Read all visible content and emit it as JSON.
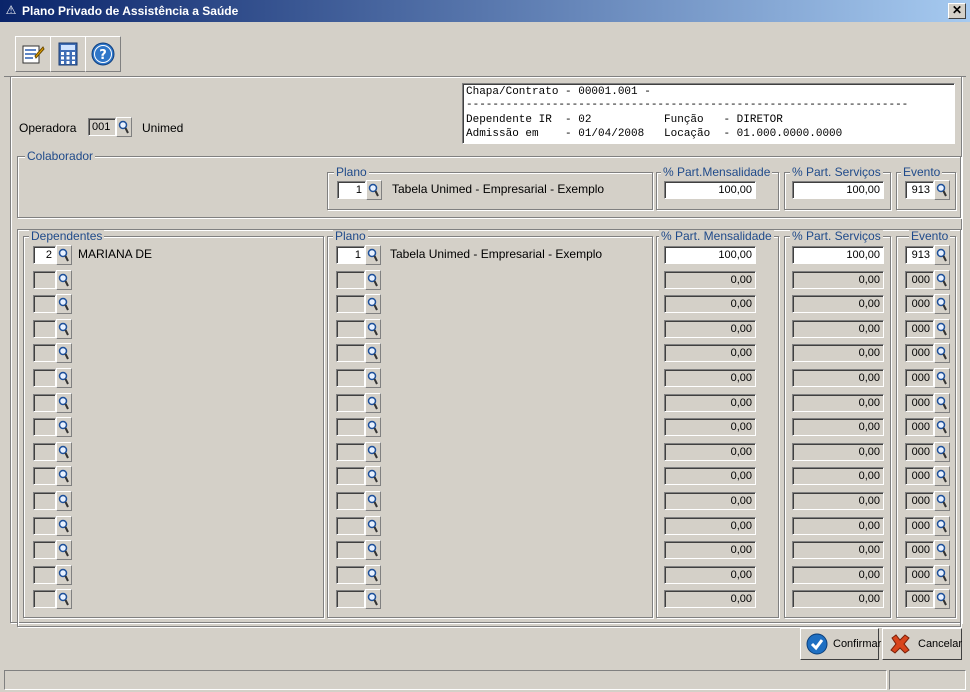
{
  "window": {
    "title": "Plano Privado de Assistência a Saúde",
    "close": "✕"
  },
  "toolbar": {
    "items": [
      {
        "icon": "edit-icon"
      },
      {
        "icon": "calculator-icon"
      },
      {
        "icon": "help-icon"
      }
    ]
  },
  "operadora": {
    "label": "Operadora",
    "code": "001",
    "name": "Unimed"
  },
  "info": {
    "line1": "Chapa/Contrato - 00001.001 -",
    "line2": "-------------------------------------------------------------------",
    "line3": "Dependente IR  - 02           Função   - DIRETOR",
    "line4": "Admissão em    - 01/04/2008   Locação  - 01.000.0000.0000"
  },
  "colaborador": {
    "legend": "Colaborador",
    "plano_legend": "Plano",
    "plano_code": "1",
    "plano_name": "Tabela Unimed - Empresarial - Exemplo",
    "mensalidade_legend": "% Part.Mensalidade",
    "mensalidade": "100,00",
    "servicos_legend": "% Part. Serviços",
    "servicos": "100,00",
    "evento_legend": "Evento",
    "evento": "913"
  },
  "dependentes": {
    "legend": "Dependentes",
    "plano_legend": "Plano",
    "mensalidade_legend": "% Part. Mensalidade",
    "servicos_legend": "% Part. Serviços",
    "evento_legend": "Evento",
    "rows": [
      {
        "code": "2",
        "name": "MARIANA DE",
        "plano": "1",
        "plano_name": "Tabela Unimed - Empresarial - Exemplo",
        "mens": "100,00",
        "serv": "100,00",
        "evento": "913",
        "active": true
      },
      {
        "code": "",
        "name": "",
        "plano": "",
        "plano_name": "",
        "mens": "0,00",
        "serv": "0,00",
        "evento": "000",
        "active": false
      },
      {
        "code": "",
        "name": "",
        "plano": "",
        "plano_name": "",
        "mens": "0,00",
        "serv": "0,00",
        "evento": "000",
        "active": false
      },
      {
        "code": "",
        "name": "",
        "plano": "",
        "plano_name": "",
        "mens": "0,00",
        "serv": "0,00",
        "evento": "000",
        "active": false
      },
      {
        "code": "",
        "name": "",
        "plano": "",
        "plano_name": "",
        "mens": "0,00",
        "serv": "0,00",
        "evento": "000",
        "active": false
      },
      {
        "code": "",
        "name": "",
        "plano": "",
        "plano_name": "",
        "mens": "0,00",
        "serv": "0,00",
        "evento": "000",
        "active": false
      },
      {
        "code": "",
        "name": "",
        "plano": "",
        "plano_name": "",
        "mens": "0,00",
        "serv": "0,00",
        "evento": "000",
        "active": false
      },
      {
        "code": "",
        "name": "",
        "plano": "",
        "plano_name": "",
        "mens": "0,00",
        "serv": "0,00",
        "evento": "000",
        "active": false
      },
      {
        "code": "",
        "name": "",
        "plano": "",
        "plano_name": "",
        "mens": "0,00",
        "serv": "0,00",
        "evento": "000",
        "active": false
      },
      {
        "code": "",
        "name": "",
        "plano": "",
        "plano_name": "",
        "mens": "0,00",
        "serv": "0,00",
        "evento": "000",
        "active": false
      },
      {
        "code": "",
        "name": "",
        "plano": "",
        "plano_name": "",
        "mens": "0,00",
        "serv": "0,00",
        "evento": "000",
        "active": false
      },
      {
        "code": "",
        "name": "",
        "plano": "",
        "plano_name": "",
        "mens": "0,00",
        "serv": "0,00",
        "evento": "000",
        "active": false
      },
      {
        "code": "",
        "name": "",
        "plano": "",
        "plano_name": "",
        "mens": "0,00",
        "serv": "0,00",
        "evento": "000",
        "active": false
      },
      {
        "code": "",
        "name": "",
        "plano": "",
        "plano_name": "",
        "mens": "0,00",
        "serv": "0,00",
        "evento": "000",
        "active": false
      },
      {
        "code": "",
        "name": "",
        "plano": "",
        "plano_name": "",
        "mens": "0,00",
        "serv": "0,00",
        "evento": "000",
        "active": false
      }
    ]
  },
  "buttons": {
    "confirm": "Confirmar",
    "cancel": "Cancelar"
  },
  "colors": {
    "title_start": "#0a246a",
    "title_end": "#a6caf0",
    "legend": "#1f4a8a",
    "face": "#d4d0c8",
    "confirm_icon": "#1e6fc2",
    "cancel_icon": "#d9451c"
  }
}
